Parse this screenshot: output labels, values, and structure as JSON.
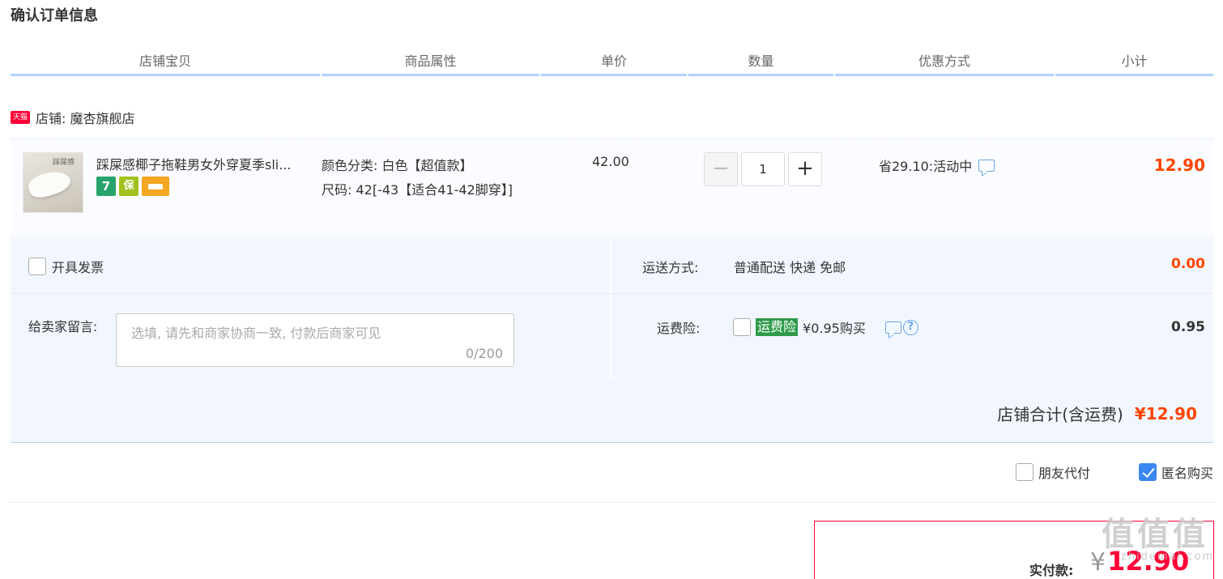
{
  "page": {
    "title": "确认订单信息"
  },
  "columns": [
    "店铺宝贝",
    "商品属性",
    "单价",
    "数量",
    "优惠方式",
    "小计"
  ],
  "shop": {
    "badge": "天猫",
    "label": "店铺: 魔杏旗舰店"
  },
  "item": {
    "thumb_text": "踩屎感",
    "title": "踩屎感椰子拖鞋男女外穿夏季sli...",
    "badges": [
      "7",
      "保",
      "card"
    ],
    "attr_color": "颜色分类: 白色【超值款】",
    "attr_size": "尺码: 42[-43【适合41-42脚穿】]",
    "unit_price": "42.00",
    "quantity": "1",
    "qty_minus": "−",
    "qty_plus": "+",
    "discount": "省29.10:活动中",
    "subtotal": "12.90"
  },
  "invoice": {
    "label": "开具发票",
    "checked": false
  },
  "message": {
    "label": "给卖家留言:",
    "placeholder": "选填, 请先和商家协商一致, 付款后商家可见",
    "count": "0/200"
  },
  "shipping": {
    "label": "运送方式:",
    "value": "普通配送 快递 免邮",
    "fee": "0.00"
  },
  "insurance": {
    "label": "运费险:",
    "tag": "运费险",
    "price_text": "¥0.95购买",
    "help": "?",
    "fee": "0.95"
  },
  "shop_total": {
    "label": "店铺合计(含运费)",
    "value": "¥12.90"
  },
  "extras": {
    "friend_pay": {
      "label": "朋友代付",
      "checked": false
    },
    "anonymous": {
      "label": "匿名购买",
      "checked": true
    }
  },
  "payment": {
    "label": "实付款:",
    "currency": "¥",
    "value": "12.90"
  },
  "watermark": {
    "main": "值值值",
    "sub": "zhidemai.com"
  },
  "colors": {
    "price_red": "#ff4400",
    "header_line": "#b2d1ff",
    "panel_bg": "#f2f7ff",
    "accent_blue": "#3a87f0",
    "insurance_green": "#2e9b4a"
  }
}
